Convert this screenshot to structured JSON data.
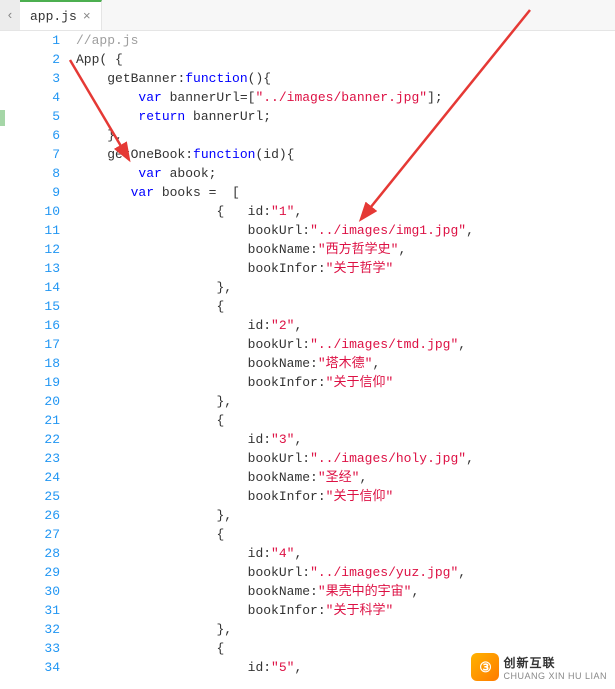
{
  "tab": {
    "filename": "app.js",
    "close_glyph": "×",
    "left_chevron": "‹"
  },
  "lines": {
    "comment": "//app.js",
    "app_open": "App( {",
    "getBanner_key": "getBanner",
    "function_kw": "function",
    "var_kw": "var",
    "return_kw": "return",
    "bannerUrl_decl": " bannerUrl=[",
    "bannerUrl_str": "\"../images/banner.jpg\"",
    "bannerUrl_end": "];",
    "bannerUrl_ret": " bannerUrl;",
    "close_brace_comma": "},",
    "getOneBook_key": "getOneBook",
    "id_param": "(id){",
    "abook_decl": " abook;",
    "books_decl": " books =  [",
    "open_brace_id": "{   id:",
    "open_brace": "{",
    "bookUrl_key": "bookUrl:",
    "bookName_key": "bookName:",
    "bookInfor_key": "bookInfor:",
    "id_key": "id:",
    "comma": ",",
    "id1": "\"1\"",
    "url1": "\"../images/img1.jpg\"",
    "name1": "\"西方哲学史\"",
    "info1": "\"关于哲学\"",
    "id2": "\"2\"",
    "url2": "\"../images/tmd.jpg\"",
    "name2": "\"塔木德\"",
    "info2": "\"关于信仰\"",
    "id3": "\"3\"",
    "url3": "\"../images/holy.jpg\"",
    "name3": "\"圣经\"",
    "info3": "\"关于信仰\"",
    "id4": "\"4\"",
    "url4": "\"../images/yuz.jpg\"",
    "name4": "\"果壳中的宇宙\"",
    "info4": "\"关于科学\"",
    "id5": "\"5\""
  },
  "watermark": {
    "badge": "③",
    "cn": "创新互联",
    "en": "CHUANG  XIN  HU  LIAN"
  },
  "gutter_start": 1,
  "gutter_end": 34
}
